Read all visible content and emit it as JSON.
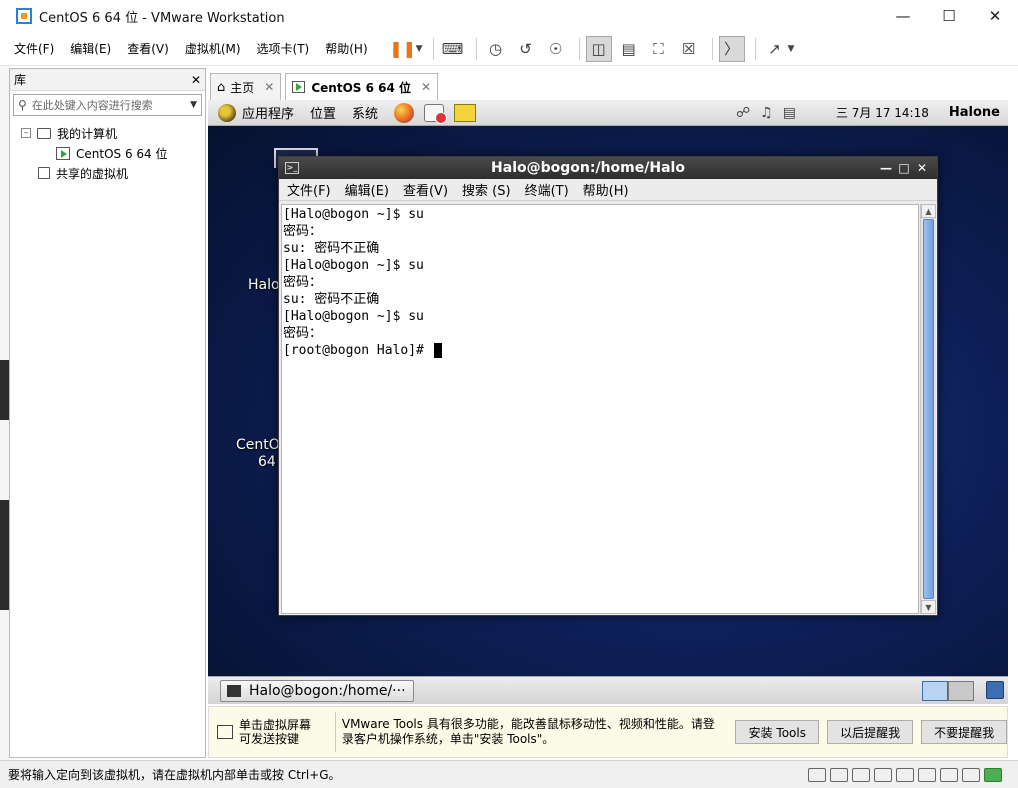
{
  "window": {
    "title": "CentOS 6 64 位 - VMware Workstation"
  },
  "menu": [
    "文件(F)",
    "编辑(E)",
    "查看(V)",
    "虚拟机(M)",
    "选项卡(T)",
    "帮助(H)"
  ],
  "library": {
    "title": "库",
    "search_placeholder": "在此处键入内容进行搜索",
    "tree": {
      "root": "我的计算机",
      "vm": "CentOS 6 64 位",
      "shared": "共享的虚拟机"
    }
  },
  "tabs": [
    {
      "label": "主页",
      "active": false
    },
    {
      "label": "CentOS 6 64 位",
      "active": true
    }
  ],
  "guest": {
    "panel": {
      "apps": "应用程序",
      "places": "位置",
      "system": "系统",
      "clock": "三 7月 17 14:18",
      "user": "Halone"
    },
    "desktop_labels": [
      "Halo",
      "CentO",
      "64"
    ],
    "terminal": {
      "title": "Halo@bogon:/home/Halo",
      "menu": [
        "文件(F)",
        "编辑(E)",
        "查看(V)",
        "搜索 (S)",
        "终端(T)",
        "帮助(H)"
      ],
      "lines": [
        "[Halo@bogon ~]$ su",
        "密码：",
        "su: 密码不正确",
        "[Halo@bogon ~]$ su",
        "密码：",
        "su: 密码不正确",
        "[Halo@bogon ~]$ su",
        "密码：",
        "[root@bogon Halo]# "
      ]
    },
    "taskbar_item": "Halo@bogon:/home/···"
  },
  "hint": {
    "left": "单击虚拟屏幕\n可发送按键",
    "message": "VMware Tools 具有很多功能，能改善鼠标移动性、视频和性能。请登录客户机操作系统，单击\"安装 Tools\"。",
    "buttons": [
      "安装 Tools",
      "以后提醒我",
      "不要提醒我"
    ]
  },
  "status": {
    "text": "要将输入定向到该虚拟机，请在虚拟机内部单击或按 Ctrl+G。"
  }
}
